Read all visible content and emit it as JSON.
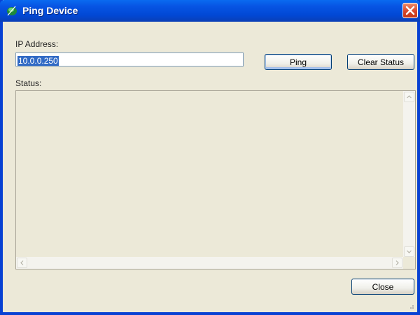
{
  "window": {
    "title": "Ping Device",
    "icon": "green-leaf-app-icon",
    "close_icon": "close-icon"
  },
  "form": {
    "ip_label": "IP Address:",
    "ip_value": "10.0.0.250",
    "ping_label": "Ping",
    "clear_status_label": "Clear Status",
    "status_label": "Status:"
  },
  "footer": {
    "close_label": "Close"
  },
  "colors": {
    "titlebar_blue": "#0754e3",
    "window_bg": "#ece9d8",
    "close_red": "#d9472b",
    "selection_blue": "#316ac5"
  }
}
